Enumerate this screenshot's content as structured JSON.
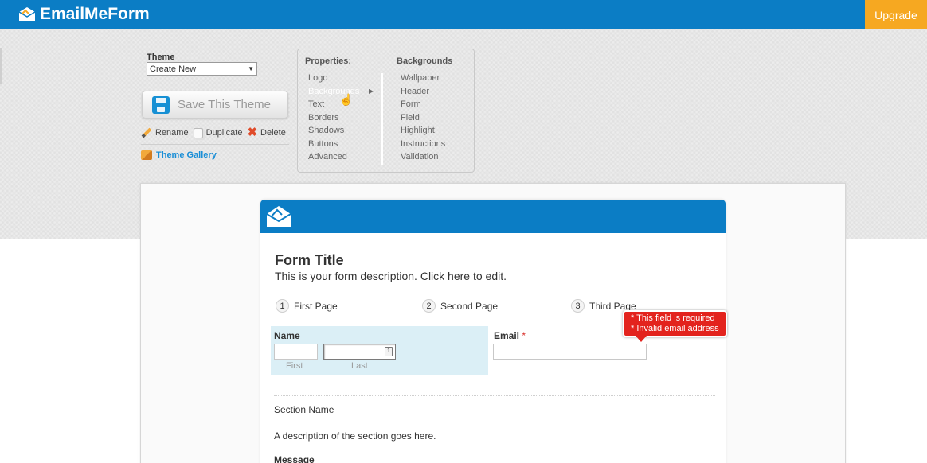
{
  "app": {
    "brand": "EmailMeForm",
    "upgrade_label": "Upgrade"
  },
  "theme_panel": {
    "label": "Theme",
    "selected": "Create New",
    "save_button": "Save This Theme",
    "rename": "Rename",
    "duplicate": "Duplicate",
    "delete": "Delete",
    "gallery": "Theme Gallery"
  },
  "properties": {
    "title": "Properties:",
    "items": [
      "Logo",
      "Backgrounds",
      "Text",
      "Borders",
      "Shadows",
      "Buttons",
      "Advanced"
    ],
    "active": "Backgrounds"
  },
  "backgrounds": {
    "title": "Backgrounds",
    "items": [
      "Wallpaper",
      "Header",
      "Form",
      "Field",
      "Highlight",
      "Instructions",
      "Validation"
    ]
  },
  "form": {
    "title": "Form Title",
    "description": "This is your form description. Click here to edit.",
    "steps": [
      {
        "num": "1",
        "label": "First Page"
      },
      {
        "num": "2",
        "label": "Second Page"
      },
      {
        "num": "3",
        "label": "Third Page"
      }
    ],
    "name_field": {
      "label": "Name",
      "first": "First",
      "last": "Last"
    },
    "email_field": {
      "label": "Email",
      "required_mark": "*"
    },
    "errors": [
      "* This field is required",
      "* Invalid email address"
    ],
    "section_name": "Section Name",
    "section_description": "A description of the section goes here.",
    "message_label": "Message"
  },
  "colors": {
    "brand_blue": "#0b7dc5",
    "upgrade_orange": "#f6a821",
    "error_red": "#e3231d",
    "highlight": "#dbeff6",
    "link_blue": "#1a8ed6"
  }
}
